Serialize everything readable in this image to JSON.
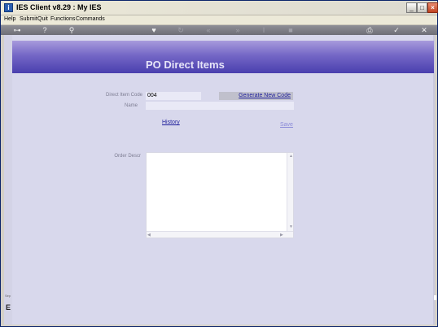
{
  "window": {
    "title": "IES Client v8.29 : My IES",
    "icon": "ies-app-icon",
    "controls": {
      "minimize": "_",
      "maximize": "□",
      "close": "×"
    }
  },
  "menu": {
    "items": [
      "Help",
      "Submit",
      "Quit",
      "Functions",
      "Commands"
    ]
  },
  "toolbar": {
    "icons": [
      "key-icon",
      "help-icon",
      "search-icon",
      "heart-icon",
      "refresh-icon",
      "rewind-icon",
      "forward-icon",
      "text-cursor-icon",
      "stop-icon",
      "print-icon",
      "check-icon",
      "close-icon"
    ]
  },
  "page": {
    "title": "PO Direct Items"
  },
  "form": {
    "code_label": "Direct Item Code",
    "code_value": "004",
    "generate_label": "Generate New Code",
    "name_label": "Name",
    "name_value": "",
    "history_label": "History",
    "save_label": "Save",
    "order_descr_label": "Order Descr",
    "order_descr_value": ""
  },
  "sidebar": {
    "separator_label": "Sep",
    "glyph": "E"
  }
}
